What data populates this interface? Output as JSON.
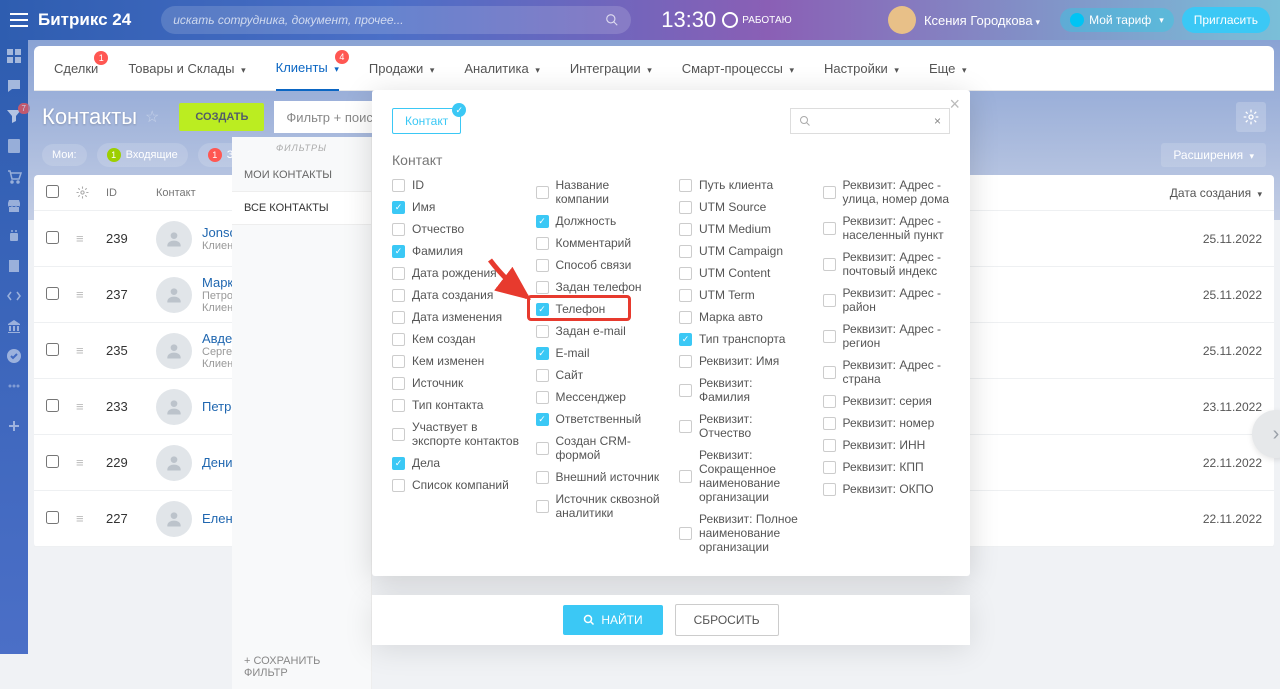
{
  "header": {
    "logo": "Битрикс 24",
    "search_placeholder": "искать сотрудника, документ, прочее...",
    "time": "13:30",
    "work_status": "РАБОТАЮ",
    "username": "Ксения Городкова",
    "tariff_btn": "Мой тариф",
    "invite_btn": "Пригласить"
  },
  "nav": {
    "items": [
      {
        "label": "Сделки",
        "badge": "1"
      },
      {
        "label": "Товары и Склады"
      },
      {
        "label": "Клиенты",
        "badge": "4",
        "active": true
      },
      {
        "label": "Продажи"
      },
      {
        "label": "Аналитика"
      },
      {
        "label": "Интеграции"
      },
      {
        "label": "Смарт-процессы"
      },
      {
        "label": "Настройки"
      },
      {
        "label": "Еще"
      }
    ]
  },
  "page": {
    "title": "Контакты",
    "create_btn": "СОЗДАТЬ",
    "filter_placeholder": "Фильтр + поиск",
    "mine_label": "Мои:",
    "pill_incoming": "Входящие",
    "pill_incoming_count": "1",
    "pill_planned": "Запланир",
    "pill_planned_count": "1",
    "extensions": "Расширения"
  },
  "table": {
    "col_id": "ID",
    "col_contact": "Контакт",
    "col_date": "Дата создания",
    "rows": [
      {
        "id": "239",
        "name": "Jonson Jac",
        "sub": "Клиенты",
        "date": "25.11.2022"
      },
      {
        "id": "237",
        "name": "Марков А",
        "sub": "Петрович",
        "sub2": "Клиенты",
        "date": "25.11.2022"
      },
      {
        "id": "235",
        "name": "Авдеев Ан",
        "sub": "Сергеевич",
        "sub2": "Клиенты",
        "date": "25.11.2022"
      },
      {
        "id": "233",
        "name": "Петров И.",
        "sub": "",
        "date": "23.11.2022"
      },
      {
        "id": "229",
        "name": "Денис",
        "sub": "",
        "date": "22.11.2022"
      },
      {
        "id": "227",
        "name": "Елена",
        "sub": "",
        "date": "22.11.2022"
      }
    ]
  },
  "filter_sidebar": {
    "header": "ФИЛЬТРЫ",
    "my_contacts": "МОИ КОНТАКТЫ",
    "all_contacts": "ВСЕ КОНТАКТЫ",
    "save_filter": "СОХРАНИТЬ ФИЛЬТР"
  },
  "modal": {
    "chip": "Контакт",
    "section_title": "Контакт",
    "find_btn": "НАЙТИ",
    "reset_btn": "СБРОСИТЬ",
    "columns": [
      [
        {
          "label": "ID",
          "checked": false
        },
        {
          "label": "Имя",
          "checked": true
        },
        {
          "label": "Отчество",
          "checked": false
        },
        {
          "label": "Фамилия",
          "checked": true
        },
        {
          "label": "Дата рождения",
          "checked": false
        },
        {
          "label": "Дата создания",
          "checked": false
        },
        {
          "label": "Дата изменения",
          "checked": false
        },
        {
          "label": "Кем создан",
          "checked": false
        },
        {
          "label": "Кем изменен",
          "checked": false
        },
        {
          "label": "Источник",
          "checked": false
        },
        {
          "label": "Тип контакта",
          "checked": false
        },
        {
          "label": "Участвует в экспорте контактов",
          "checked": false
        },
        {
          "label": "Дела",
          "checked": true
        },
        {
          "label": "Список компаний",
          "checked": false
        }
      ],
      [
        {
          "label": "Название компании",
          "checked": false
        },
        {
          "label": "Должность",
          "checked": true
        },
        {
          "label": "Комментарий",
          "checked": false
        },
        {
          "label": "Способ связи",
          "checked": false
        },
        {
          "label": "Задан телефон",
          "checked": false
        },
        {
          "label": "Телефон",
          "checked": true
        },
        {
          "label": "Задан e-mail",
          "checked": false
        },
        {
          "label": "E-mail",
          "checked": true
        },
        {
          "label": "Сайт",
          "checked": false
        },
        {
          "label": "Мессенджер",
          "checked": false
        },
        {
          "label": "Ответственный",
          "checked": true
        },
        {
          "label": "Создан CRM-формой",
          "checked": false
        },
        {
          "label": "Внешний источник",
          "checked": false
        },
        {
          "label": "Источник сквозной аналитики",
          "checked": false
        }
      ],
      [
        {
          "label": "Путь клиента",
          "checked": false
        },
        {
          "label": "UTM Source",
          "checked": false
        },
        {
          "label": "UTM Medium",
          "checked": false
        },
        {
          "label": "UTM Campaign",
          "checked": false
        },
        {
          "label": "UTM Content",
          "checked": false
        },
        {
          "label": "UTM Term",
          "checked": false
        },
        {
          "label": "Марка авто",
          "checked": false
        },
        {
          "label": "Тип транспорта",
          "checked": true
        },
        {
          "label": "Реквизит: Имя",
          "checked": false
        },
        {
          "label": "Реквизит: Фамилия",
          "checked": false
        },
        {
          "label": "Реквизит: Отчество",
          "checked": false
        },
        {
          "label": "Реквизит: Сокращенное наименование организации",
          "checked": false
        },
        {
          "label": "Реквизит: Полное наименование организации",
          "checked": false
        }
      ],
      [
        {
          "label": "Реквизит: Адрес - улица, номер дома",
          "checked": false
        },
        {
          "label": "Реквизит: Адрес - населенный пункт",
          "checked": false
        },
        {
          "label": "Реквизит: Адрес - почтовый индекс",
          "checked": false
        },
        {
          "label": "Реквизит: Адрес - район",
          "checked": false
        },
        {
          "label": "Реквизит: Адрес - регион",
          "checked": false
        },
        {
          "label": "Реквизит: Адрес - страна",
          "checked": false
        },
        {
          "label": "Реквизит: серия",
          "checked": false
        },
        {
          "label": "Реквизит: номер",
          "checked": false
        },
        {
          "label": "Реквизит: ИНН",
          "checked": false
        },
        {
          "label": "Реквизит: КПП",
          "checked": false
        },
        {
          "label": "Реквизит: ОКПО",
          "checked": false
        }
      ]
    ]
  }
}
